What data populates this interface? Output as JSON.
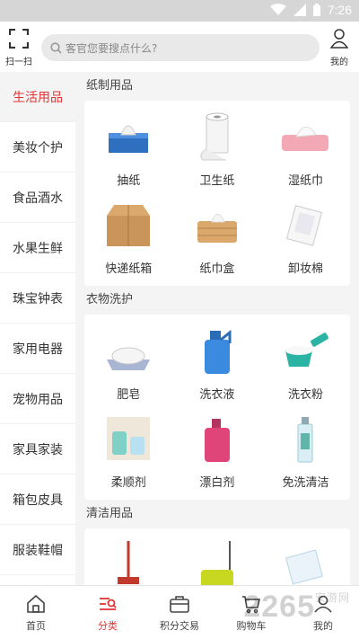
{
  "status": {
    "time": "7:26"
  },
  "header": {
    "scan_label": "扫一扫",
    "search_placeholder": "客官您要搜点什么?",
    "me_label": "我的"
  },
  "sidebar": {
    "items": [
      {
        "label": "生活用品",
        "active": true
      },
      {
        "label": "美妆个护"
      },
      {
        "label": "食品酒水"
      },
      {
        "label": "水果生鲜"
      },
      {
        "label": "珠宝钟表"
      },
      {
        "label": "家用电器"
      },
      {
        "label": "宠物用品"
      },
      {
        "label": "家具家装"
      },
      {
        "label": "箱包皮具"
      },
      {
        "label": "服装鞋帽"
      }
    ]
  },
  "sections": [
    {
      "title": "纸制用品",
      "items": [
        "抽纸",
        "卫生纸",
        "湿纸巾",
        "快递纸箱",
        "纸巾盒",
        "卸妆棉"
      ]
    },
    {
      "title": "衣物洗护",
      "items": [
        "肥皂",
        "洗衣液",
        "洗衣粉",
        "柔顺剂",
        "漂白剂",
        "免洗清洁"
      ]
    },
    {
      "title": "清洁用品",
      "items": [
        "",
        "",
        ""
      ]
    }
  ],
  "bottom_nav": [
    {
      "label": "首页",
      "icon": "home-icon"
    },
    {
      "label": "分类",
      "icon": "category-icon",
      "active": true
    },
    {
      "label": "积分交易",
      "icon": "briefcase-icon"
    },
    {
      "label": "购物车",
      "icon": "cart-icon"
    },
    {
      "label": "我的",
      "icon": "user-icon"
    }
  ],
  "watermark": {
    "text": "2265",
    "suffix": "安游网"
  },
  "colors": {
    "accent": "#e33333",
    "background": "#f4f4f4"
  }
}
